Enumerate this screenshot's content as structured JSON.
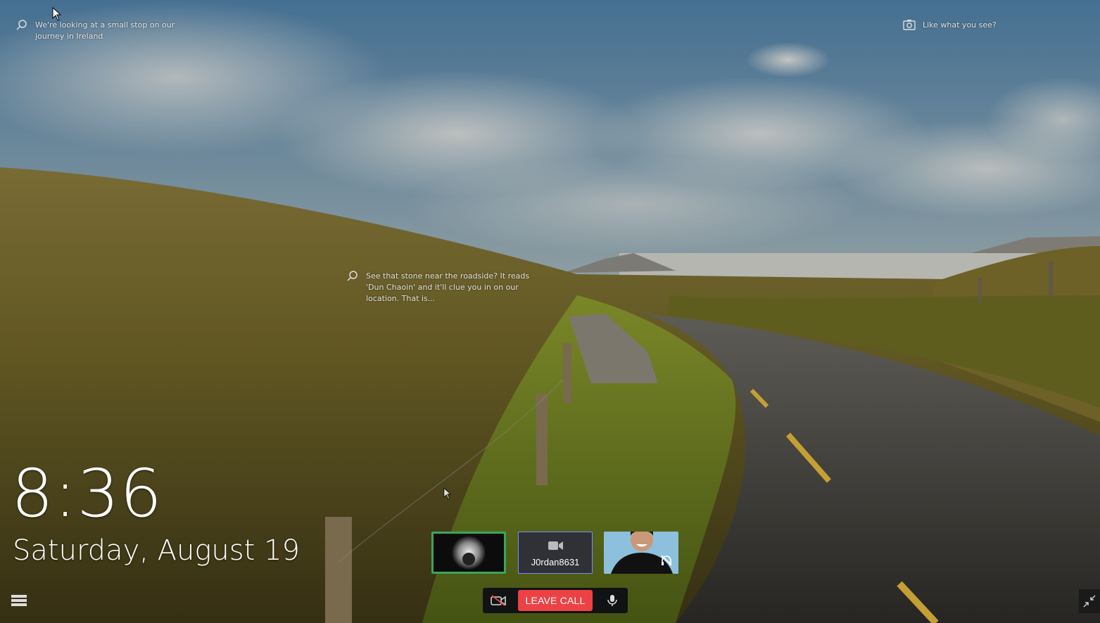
{
  "spotlight": {
    "top_left": {
      "text": "We're looking at a small stop on our journey in Ireland",
      "icon": "search-icon"
    },
    "top_right": {
      "text": "Like what you see?",
      "icon": "camera-icon"
    },
    "middle": {
      "text": "See that stone near the roadside? It reads 'Dun Chaoin' and it'll clue you in on our location. That is...",
      "icon": "search-icon"
    }
  },
  "lockscreen": {
    "time": "8:36",
    "date": "Saturday, August 19"
  },
  "call": {
    "participants": [
      {
        "name": "",
        "type": "avatar-image",
        "speaking": true
      },
      {
        "name": "J0rdan8631",
        "type": "camera-off"
      },
      {
        "name": "",
        "type": "video",
        "deafened": true
      }
    ],
    "leave_label": "LEAVE CALL",
    "colors": {
      "leave": "#ed4245",
      "speaking": "#3ba55d",
      "bar": "#111214"
    }
  }
}
